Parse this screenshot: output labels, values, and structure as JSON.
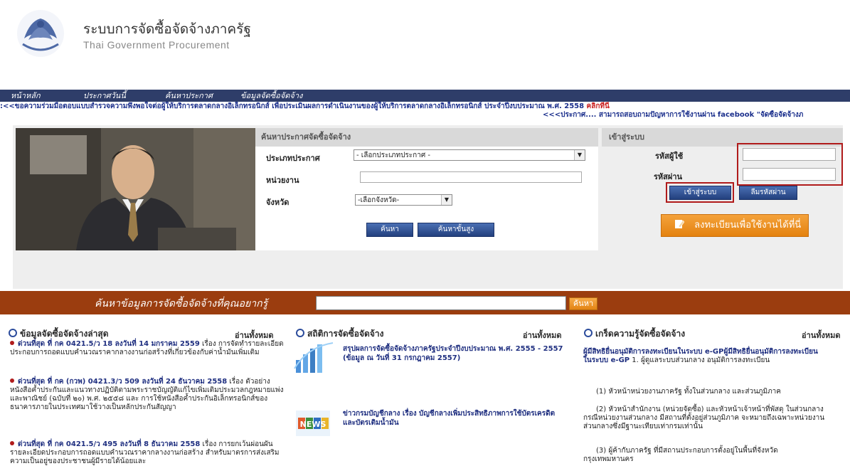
{
  "header": {
    "title": "ระบบการจัดซื้อจัดจ้างภาครัฐ",
    "subtitle": "Thai Government Procurement"
  },
  "nav": {
    "items": [
      "หน้าหลัก",
      "ประกาศวันนี้",
      "ค้นหาประกาศ",
      "ข้อมูลจัดซื้อจัดจ้าง"
    ]
  },
  "ticker": {
    "line1": ":<<ขอความร่วมมือตอบแบบสำรวจความพึงพอใจต่อผู้ให้บริการตลาดกลางอิเล็กทรอนิกส์ เพื่อประเมินผลการดำเนินงานของผู้ให้บริการตลาดกลางอิเล็กทรอนิกส์ ประจำปีงบประมาณ พ.ศ. 2558 ",
    "line1_link": "คลิกที่นี่",
    "line2": "<<<ประกาศ.... สามารถสอบถามปัญหาการใช้งานผ่าน facebook \"จัดซื้อจัดจ้างภ"
  },
  "search": {
    "heading": "ค้นหาประกาศจัดซื้อจัดจ้าง",
    "type_label": "ประเภทประกาศ",
    "type_value": "- เลือกประเภทประกาศ -",
    "agency_label": "หน่วยงาน",
    "agency_value": "",
    "province_label": "จังหวัด",
    "province_value": "-เลือกจังหวัด-",
    "search_button": "ค้นหา",
    "advanced_button": "ค้นหาขั้นสูง"
  },
  "login": {
    "heading": "เข้าสู่ระบบ",
    "user_label": "รหัสผู้ใช้",
    "pass_label": "รหัสผ่าน",
    "login_button": "เข้าสู่ระบบ",
    "forgot_button": "ลืมรหัสผ่าน",
    "register_button": "ลงทะเบียนเพื่อใช้งานได้ที่นี่"
  },
  "quick_search": {
    "label": "ค้นหาข้อมูลการจัดซื้อจัดจ้างที่คุณอยากรู้",
    "value": "",
    "button": "ค้นหา"
  },
  "columns": {
    "latest": {
      "heading": "ข้อมูลจัดซื้อจัดจ้างล่าสุด",
      "readall": "อ่านทั้งหมด",
      "items": [
        {
          "bold": "ด่วนที่สุด ที่ กค 0421.5/ว 18 ลงวันที่ 14 มกราคม 2559",
          "text": " เรื่อง การจัดทำรายละเอียดประกอบการถอดแบบคำนวณราคากลางงานก่อสร้างที่เกี่ยวข้องกับค่าน้ำมันเพิ่มเติม"
        },
        {
          "bold": "ด่วนที่สุด ที่ กค (กวพ) 0421.3/ว 509 ลงวันที่ 24 ธันวาคม 2558",
          "text": " เรื่อง ตัวอย่างหนังสือค้ำประกันและแนวทางปฏิบัติตามพระราชบัญญัติแก้ไขเพิ่มเติมประมวลกฎหมายแพ่งและพาณิชย์ (ฉบับที่ ๒๐) พ.ศ. ๒๕๕๘ และ การใช้หนังสือค้ำประกันอิเล็กทรอนิกส์ของธนาคารภายในประเทศมาใช้วางเป็นหลักประกันสัญญา"
        },
        {
          "bold": "ด่วนที่สุด ที่ กค 0421.5/ว 495 ลงวันที่ 8 ธันวาคม 2558",
          "text": " เรื่อง การยกเว้นผ่อนผันรายละเอียดประกอบการถอดแบบคำนวณราคากลางงานก่อสร้าง สำหรับมาตรการส่งเสริมความเป็นอยู่ของประชาชนผู้มีรายได้น้อยและ"
        }
      ]
    },
    "stats": {
      "heading": "สถิติการจัดซื้อจัดจ้าง",
      "readall": "อ่านทั้งหมด",
      "items": [
        "สรุปผลการจัดซื้อจัดจ้างภาครัฐประจำปีงบประมาณ พ.ศ. 2555 - 2557 (ข้อมูล ณ วันที่ 31 กรกฎาคม 2557)",
        "ข่าวกรมบัญชีกลาง เรื่อง บัญชีกลางเพิ่มประสิทธิภาพการใช้บัตรเครดิตและบัตรเติมน้ำมัน"
      ],
      "news_badge": "NEWS"
    },
    "knowledge": {
      "heading": "เกร็ดความรู้จัดซื้อจัดจ้าง",
      "readall": "อ่านทั้งหมด",
      "link": "ผู้มีสิทธิยื่นอนุมัติการลงทะเบียนในระบบ e-GPผู้มีสิทธิยื่นอนุมัติการลงทะเบียนในระบบ e-GP",
      "intro": " 1. ผู้ดูแลระบบส่วนกลาง อนุมัติการลงทะเบียน",
      "lines": [
        "(1) หัวหน้าหน่วยงานภาครัฐ ทั้งในส่วนกลาง และส่วนภูมิภาค",
        "(2) หัวหน้าสำนักงาน (หน่วยจัดซื้อ) และหัวหน้าเจ้าหน้าที่พัสดุ ในส่วนกลาง กรณีหน่วยงานส่วนกลาง มีสถานที่ตั้งอยู่ส่วนภูมิภาค จะหมายถึงเฉพาะหน่วยงานส่วนกลางซึ่งมีฐานะเทียบเท่ากรมเท่านั้น",
        "(3) ผู้ค้ากับภาครัฐ ที่มีสถานประกอบการตั้งอยู่ในพื้นที่จังหวัดกรุงเทพมหานคร"
      ]
    }
  }
}
